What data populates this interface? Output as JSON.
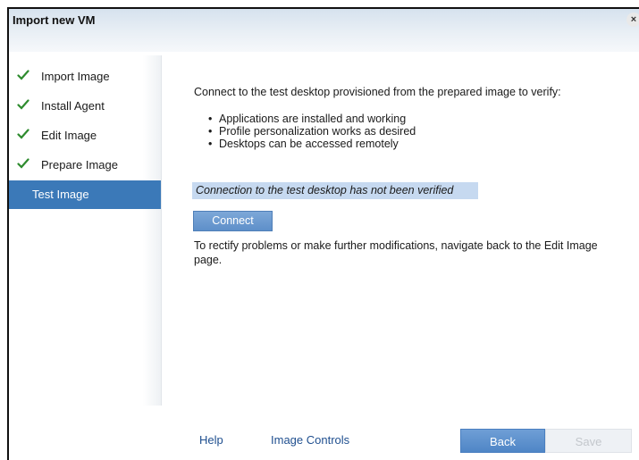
{
  "window": {
    "title": "Import new VM",
    "close_label": "×"
  },
  "sidebar": {
    "items": [
      {
        "label": "Import Image",
        "completed": true
      },
      {
        "label": "Install Agent",
        "completed": true
      },
      {
        "label": "Edit Image",
        "completed": true
      },
      {
        "label": "Prepare Image",
        "completed": true
      },
      {
        "label": "Test Image",
        "completed": false,
        "active": true
      }
    ]
  },
  "main": {
    "intro": "Connect to the test desktop provisioned from the prepared image to verify:",
    "bullets": [
      "Applications are installed and working",
      "Profile personalization works as desired",
      "Desktops can be accessed remotely"
    ],
    "status": "Connection to the test desktop has not been verified",
    "connect_label": "Connect",
    "note": "To rectify problems or make further modifications, navigate back to the Edit Image page."
  },
  "footer": {
    "help_label": "Help",
    "image_controls_label": "Image Controls",
    "back_label": "Back",
    "save_label": "Save"
  },
  "colors": {
    "check_green": "#2e8b2e",
    "active_step_bg": "#3b79b8",
    "status_highlight": "#c6d9f0",
    "link_blue": "#1f4f8f"
  },
  "icons": {
    "check": "check-icon",
    "close": "close-icon"
  }
}
